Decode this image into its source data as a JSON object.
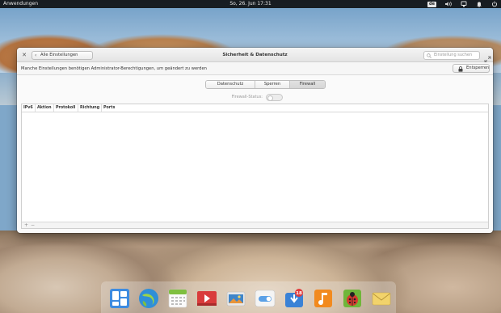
{
  "panel": {
    "applications_label": "Anwendungen",
    "datetime": "So, 26. Jun    17:31",
    "keyboard_layout": "de"
  },
  "window": {
    "back_label": "Alle Einstellungen",
    "title": "Sicherheit & Datenschutz",
    "search_placeholder": "Einstellung suchen",
    "info_text": "Manche Einstellungen benötigen Administrator-Berechtigungen, um geändert zu werden",
    "unlock_label": "Entsperren",
    "tabs": [
      {
        "label": "Datenschutz",
        "active": false
      },
      {
        "label": "Sperren",
        "active": false
      },
      {
        "label": "Firewall",
        "active": true
      }
    ],
    "firewall_status_label": "Firewall-Status:",
    "firewall_enabled": false,
    "table": {
      "columns": [
        "IPv6",
        "Aktion",
        "Protokoll",
        "Richtung",
        "Ports"
      ],
      "rows": []
    },
    "footer": {
      "add_label": "+",
      "remove_label": "−"
    }
  },
  "dock": {
    "items": [
      {
        "name": "multitasking-view",
        "color": "#3d8be0"
      },
      {
        "name": "web-browser",
        "color": "#2f8fd8"
      },
      {
        "name": "calendar",
        "color": "#7fbf3f"
      },
      {
        "name": "videos",
        "color": "#d93b3b"
      },
      {
        "name": "photos",
        "color": "#e8943a"
      },
      {
        "name": "system-settings",
        "color": "#5aa0e6"
      },
      {
        "name": "appcenter",
        "color": "#3a82d6",
        "badge": "18"
      },
      {
        "name": "music",
        "color": "#f28a1e"
      },
      {
        "name": "bug-app",
        "color": "#6fb63a"
      },
      {
        "name": "mail",
        "color": "#f2d36b"
      }
    ]
  },
  "colors": {
    "panel_bg": "#0a0a0a",
    "window_bg": "#fafafa",
    "badge_red": "#e23b3b"
  }
}
